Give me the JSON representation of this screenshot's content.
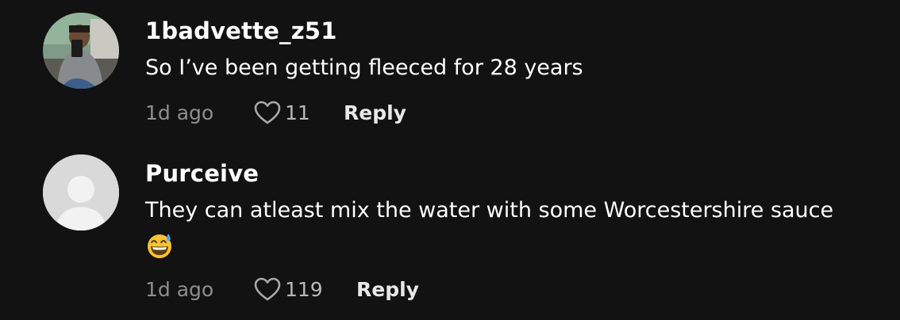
{
  "comments": [
    {
      "username": "1badvette_z51",
      "text": "So I’ve been getting fleeced for 28 years",
      "time": "1d ago",
      "likes": "11",
      "reply_label": "Reply",
      "avatar": "user-photo"
    },
    {
      "username": "Purceive",
      "text": "They can atleast mix the water with some Worcestershire sauce",
      "emoji": "grinning-face-with-sweat-emoji",
      "time": "1d ago",
      "likes": "119",
      "reply_label": "Reply",
      "avatar": "default-avatar"
    }
  ],
  "colors": {
    "background": "#121212",
    "text": "#ffffff",
    "muted": "#8e8e8e",
    "placeholder_avatar": "#d9d9d9"
  }
}
